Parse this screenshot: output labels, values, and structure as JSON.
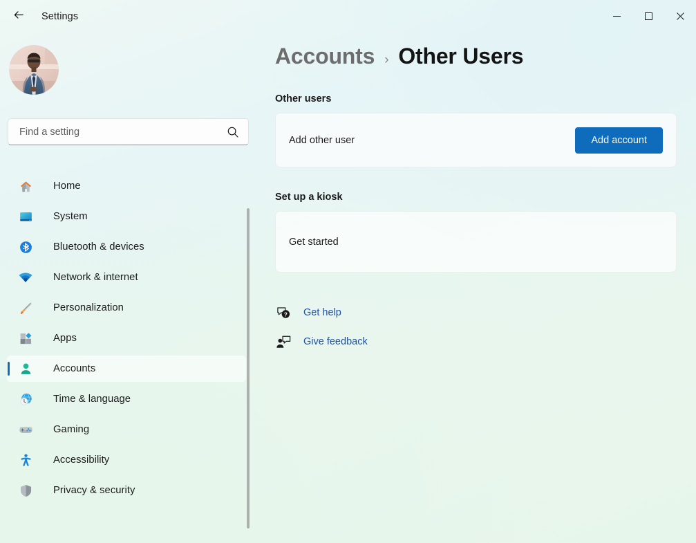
{
  "window": {
    "title": "Settings",
    "back_icon": "back-arrow-icon",
    "controls": {
      "minimize": "minimize-icon",
      "maximize": "maximize-icon",
      "close": "close-icon"
    }
  },
  "sidebar": {
    "avatar": "user-avatar-photo",
    "search": {
      "placeholder": "Find a setting",
      "value": "",
      "icon": "search-icon"
    },
    "items": [
      {
        "label": "Home",
        "icon": "home-icon",
        "selected": false
      },
      {
        "label": "System",
        "icon": "system-icon",
        "selected": false
      },
      {
        "label": "Bluetooth & devices",
        "icon": "bluetooth-icon",
        "selected": false
      },
      {
        "label": "Network & internet",
        "icon": "wifi-icon",
        "selected": false
      },
      {
        "label": "Personalization",
        "icon": "paintbrush-icon",
        "selected": false
      },
      {
        "label": "Apps",
        "icon": "apps-icon",
        "selected": false
      },
      {
        "label": "Accounts",
        "icon": "person-icon",
        "selected": true
      },
      {
        "label": "Time & language",
        "icon": "clock-globe-icon",
        "selected": false
      },
      {
        "label": "Gaming",
        "icon": "gamepad-icon",
        "selected": false
      },
      {
        "label": "Accessibility",
        "icon": "accessibility-icon",
        "selected": false
      },
      {
        "label": "Privacy & security",
        "icon": "shield-icon",
        "selected": false
      }
    ]
  },
  "main": {
    "breadcrumb": {
      "parent": "Accounts",
      "separator": "›",
      "current": "Other Users"
    },
    "sections": [
      {
        "title": "Other users",
        "card_label": "Add other user",
        "button_label": "Add account"
      },
      {
        "title": "Set up a kiosk",
        "card_label": "Get started"
      }
    ],
    "links": [
      {
        "label": "Get help",
        "icon": "help-question-bubble-icon"
      },
      {
        "label": "Give feedback",
        "icon": "feedback-person-bubble-icon"
      }
    ]
  },
  "colors": {
    "accent": "#0f6cbd",
    "link": "#1b51a8",
    "selection_pill": "#0f6cbd"
  }
}
